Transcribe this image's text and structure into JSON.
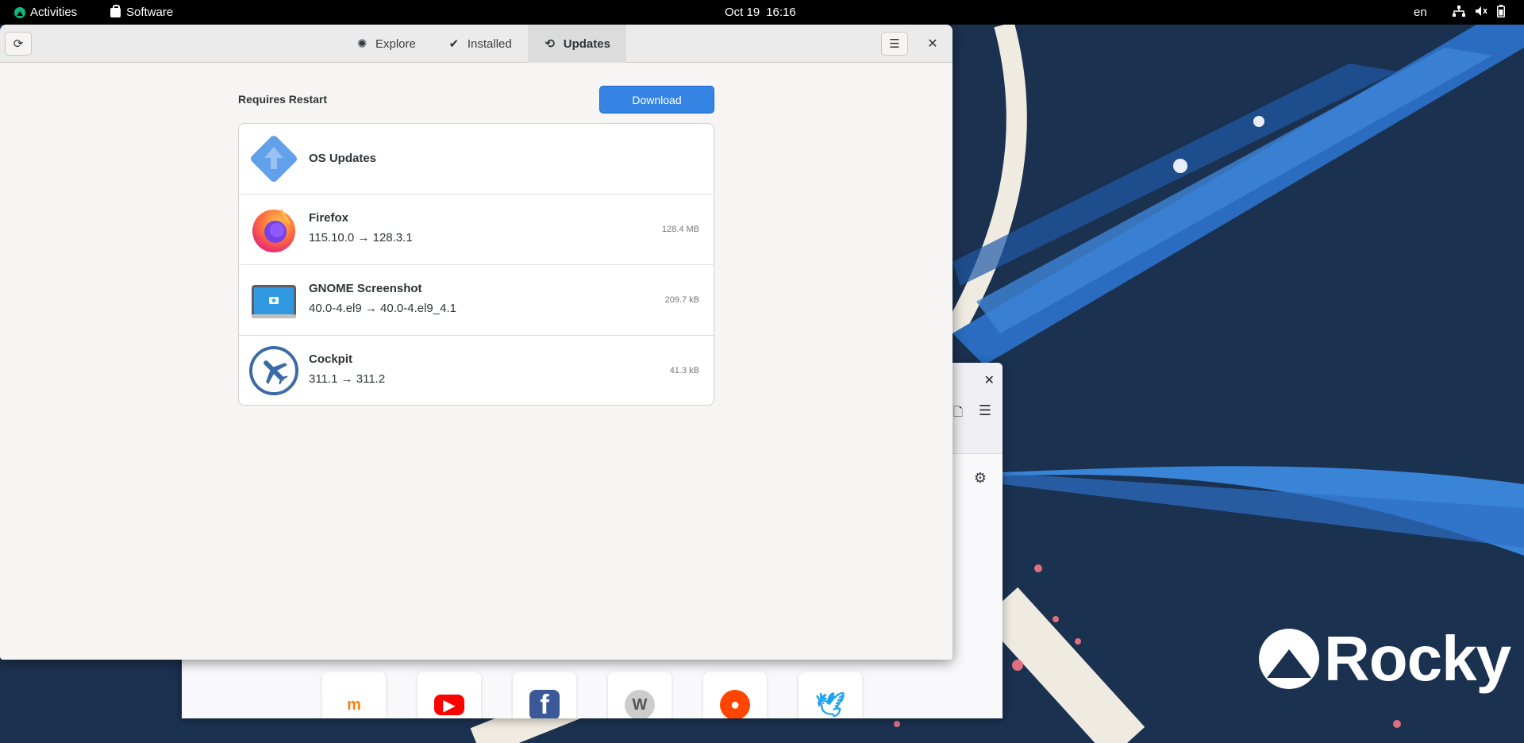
{
  "topbar": {
    "activities": "Activities",
    "app_name": "Software",
    "date": "Oct 19",
    "time": "16:16",
    "language": "en"
  },
  "window": {
    "tabs": [
      {
        "label": "Explore",
        "icon": "explore-icon",
        "active": false
      },
      {
        "label": "Installed",
        "icon": "installed-check-icon",
        "active": false
      },
      {
        "label": "Updates",
        "icon": "updates-sync-icon",
        "active": true
      }
    ]
  },
  "updates": {
    "section_title": "Requires Restart",
    "download_label": "Download",
    "items": [
      {
        "name": "OS Updates",
        "version": "",
        "size": "",
        "icon": "os-updates-icon"
      },
      {
        "name": "Firefox",
        "version": "115.10.0 → 128.3.1",
        "size": "128.4 MB",
        "icon": "firefox-icon"
      },
      {
        "name": "GNOME Screenshot",
        "version": "40.0-4.el9 → 40.0-4.el9_4.1",
        "size": "209.7 kB",
        "icon": "gnome-screenshot-icon"
      },
      {
        "name": "Cockpit",
        "version": "311.1 → 311.2",
        "size": "41.3 kB",
        "icon": "cockpit-icon"
      }
    ]
  },
  "background_window": {
    "shortcuts": [
      "moodle-icon",
      "youtube-icon",
      "facebook-icon",
      "wikipedia-icon",
      "reddit-icon",
      "twitter-icon"
    ]
  },
  "desktop": {
    "brand": "Rocky"
  },
  "colors": {
    "accent": "#3584e4",
    "topbar": "#000000",
    "desktop": "#1b3150"
  }
}
